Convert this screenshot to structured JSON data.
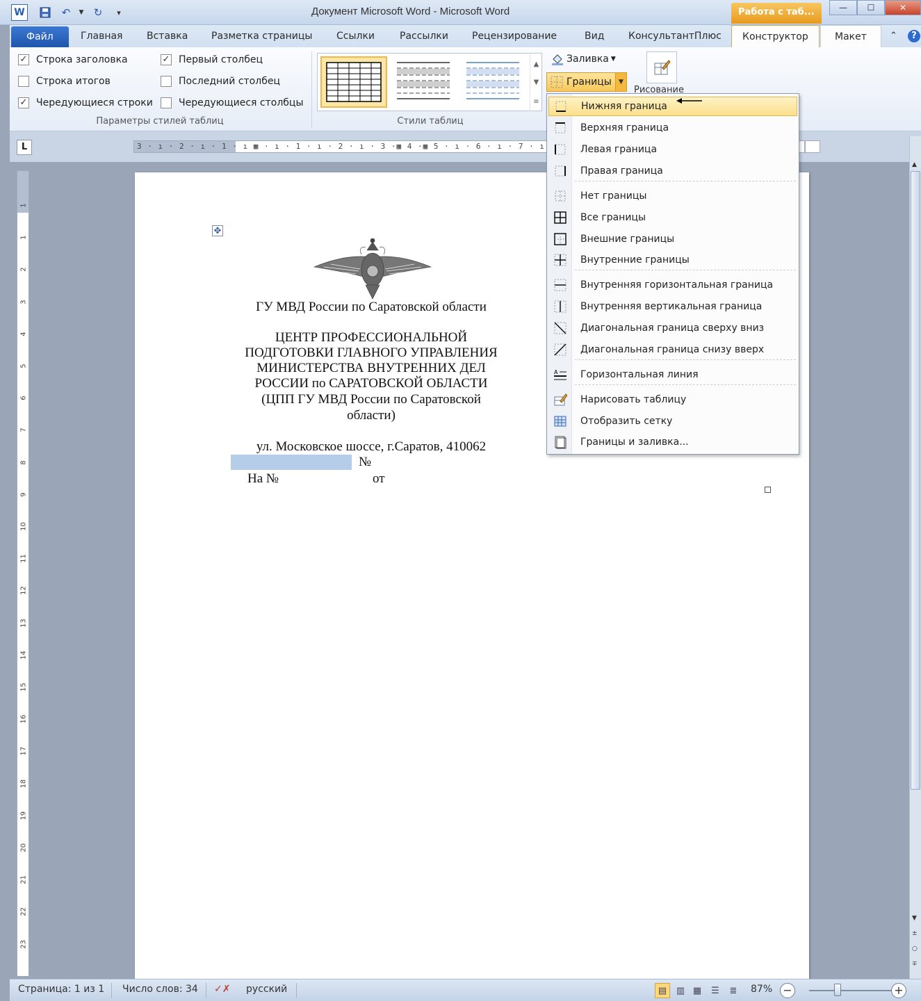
{
  "titlebar": {
    "title": "Документ Microsoft Word  -  Microsoft Word",
    "context_tab": "Работа с таб...",
    "minimize": "—",
    "maximize": "☐",
    "close": "✕"
  },
  "tabs": [
    {
      "label": "Файл"
    },
    {
      "label": "Главная"
    },
    {
      "label": "Вставка"
    },
    {
      "label": "Разметка страницы"
    },
    {
      "label": "Ссылки"
    },
    {
      "label": "Рассылки"
    },
    {
      "label": "Рецензирование"
    },
    {
      "label": "Вид"
    },
    {
      "label": "КонсультантПлюс"
    },
    {
      "label": "Конструктор"
    },
    {
      "label": "Макет"
    }
  ],
  "ribbon": {
    "table_style_options": {
      "title": "Параметры стилей таблиц",
      "checkboxes": [
        {
          "label": "Строка заголовка",
          "checked": true
        },
        {
          "label": "Строка итогов",
          "checked": false
        },
        {
          "label": "Чередующиеся строки",
          "checked": true
        },
        {
          "label": "Первый столбец",
          "checked": true
        },
        {
          "label": "Последний столбец",
          "checked": false
        },
        {
          "label": "Чередующиеся столбцы",
          "checked": false
        }
      ]
    },
    "table_styles": {
      "title": "Стили таблиц"
    },
    "shading_label": "Заливка",
    "borders_label": "Границы",
    "draw_label": "Рисование"
  },
  "ruler": {
    "text": "3 · ı · 2 · ı · 1 · ı ▦ · ı · 1 · ı · 2 · ı · 3 ·▦ 4 ·▦ 5 · ı · 6 · ı · 7 · ı · 8 · ▦ 9 · ı"
  },
  "vruler_marks": [
    "1",
    "1",
    "2",
    "3",
    "4",
    "5",
    "6",
    "7",
    "8",
    "9",
    "10",
    "11",
    "12",
    "13",
    "14",
    "15",
    "16",
    "17",
    "18",
    "19",
    "20",
    "21",
    "22",
    "23"
  ],
  "document": {
    "org_line": "ГУ МВД России по Саратовской области",
    "center_lines": [
      "ЦЕНТР ПРОФЕССИОНАЛЬНОЙ",
      "ПОДГОТОВКИ ГЛАВНОГО УПРАВЛЕНИЯ",
      "МИНИСТЕРСТВА  ВНУТРЕННИХ ДЕЛ",
      "РОССИИ по САРАТОВСКОЙ ОБЛАСТИ",
      "(ЦПП ГУ МВД России по Саратовской",
      "области)"
    ],
    "address": "ул. Московское шоссе, г.Саратов, 410062",
    "number_sign": "№",
    "reply_no": "На №",
    "from": "от"
  },
  "borders_menu": {
    "items": [
      {
        "label": "Нижняя граница",
        "icon": "border-bottom-icon",
        "highlighted": true
      },
      {
        "label": "Верхняя граница",
        "icon": "border-top-icon"
      },
      {
        "label": "Левая граница",
        "icon": "border-left-icon"
      },
      {
        "label": "Правая граница",
        "icon": "border-right-icon"
      },
      {
        "label": "Нет границы",
        "icon": "border-none-icon"
      },
      {
        "label": "Все границы",
        "icon": "border-all-icon"
      },
      {
        "label": "Внешние границы",
        "icon": "border-outside-icon"
      },
      {
        "label": "Внутренние границы",
        "icon": "border-inside-icon"
      },
      {
        "label": "Внутренняя горизонтальная граница",
        "icon": "border-inside-horizontal-icon"
      },
      {
        "label": "Внутренняя вертикальная граница",
        "icon": "border-inside-vertical-icon"
      },
      {
        "label": "Диагональная граница сверху вниз",
        "icon": "border-diagonal-down-icon"
      },
      {
        "label": "Диагональная граница снизу вверх",
        "icon": "border-diagonal-up-icon"
      },
      {
        "label": "Горизонтальная линия",
        "icon": "horizontal-line-icon"
      },
      {
        "label": "Нарисовать таблицу",
        "icon": "draw-table-icon"
      },
      {
        "label": "Отобразить сетку",
        "icon": "view-gridlines-icon"
      },
      {
        "label": "Границы и заливка...",
        "icon": "borders-shading-dialog-icon"
      }
    ]
  },
  "statusbar": {
    "page": "Страница: 1 из 1",
    "words": "Число слов: 34",
    "language": "русский",
    "zoom": "87%",
    "zoom_out": "−",
    "zoom_in": "+"
  },
  "colors": {
    "accent_orange": "#f8c85a",
    "file_tab_blue": "#1f55ad",
    "selection_blue": "#b5cde9"
  }
}
